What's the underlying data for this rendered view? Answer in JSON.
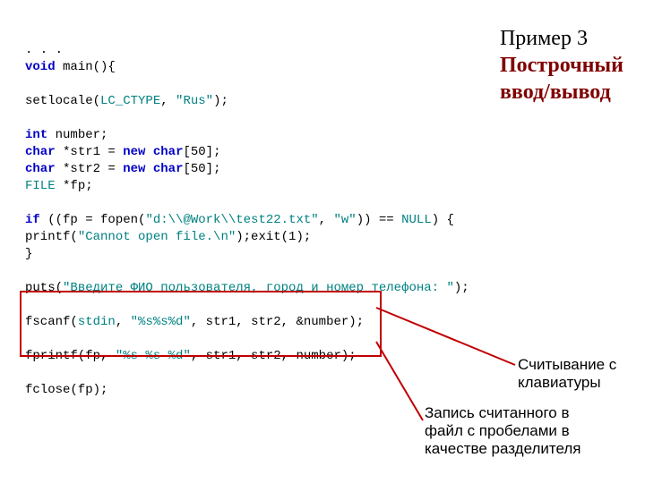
{
  "title": {
    "example": "Пример 3",
    "line1": "Построчный",
    "line2": "ввод/вывод"
  },
  "code": {
    "l1a": ". . .",
    "l2a": "void",
    "l2b": " main(){",
    "l3_blank": " ",
    "l4a": "setlocale(",
    "l4b": "LC_CTYPE",
    "l4c": ", ",
    "l4d": "\"Rus\"",
    "l4e": ");",
    "l5_blank": " ",
    "l6a": "int",
    "l6b": " number;",
    "l7a": "char",
    "l7b": " *str1 = ",
    "l7c": "new",
    "l7d": " ",
    "l7e": "char",
    "l7f": "[50];",
    "l8a": "char",
    "l8b": " *str2 = ",
    "l8c": "new",
    "l8d": " ",
    "l8e": "char",
    "l8f": "[50];",
    "l9a": "FILE",
    "l9b": " *fp;",
    "l10_blank": " ",
    "l11a": "if",
    "l11b": " ((fp = fopen(",
    "l11c": "\"d:\\\\@Work\\\\test22.txt\"",
    "l11d": ", ",
    "l11e": "\"w\"",
    "l11f": ")) == ",
    "l11g": "NULL",
    "l11h": ") {",
    "l12a": "printf(",
    "l12b": "\"Cannot open file.\\n\"",
    "l12c": ");exit(1);",
    "l13a": "}",
    "l14_blank": " ",
    "l15a": "puts(",
    "l15b": "\"Введите ФИО пользователя, город и номер телефона: \"",
    "l15c": ");",
    "l16_blank": " ",
    "l17a": "fscanf(",
    "l17b": "stdin",
    "l17c": ", ",
    "l17d": "\"%s%s%d\"",
    "l17e": ", str1, str2, &number);",
    "l18_blank": " ",
    "l19a": "fprintf(fp, ",
    "l19b": "\"%s %s %d\"",
    "l19c": ", str1, str2, number);",
    "l20_blank": " ",
    "l21a": "fclose(fp);"
  },
  "annotations": {
    "a1_l1": "Считывание с",
    "a1_l2": "клавиатуры",
    "a2_l1": "Запись считанного в",
    "a2_l2": "файл с пробелами в",
    "a2_l3": "качестве разделителя"
  },
  "chart_data": null
}
